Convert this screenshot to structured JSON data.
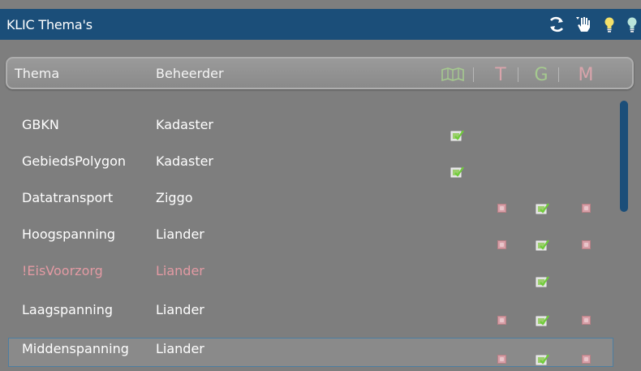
{
  "window": {
    "title": "KLIC Thema's",
    "icons": [
      "refresh-icon",
      "hand-pointer-icon",
      "lightbulb-icon",
      "lightbulb-icon"
    ]
  },
  "header": {
    "thema_label": "Thema",
    "beheerder_label": "Beheerder",
    "map_icon": "map-icon",
    "col_t": "T",
    "col_g": "G",
    "col_m": "M"
  },
  "colors": {
    "titlebar": "#1b4e79",
    "background": "#7e7e7e",
    "check_green": "#8ed44a",
    "x_pink": "#d79fa7",
    "warn_text": "#e39aa3",
    "header_map_green": "#a5c98f",
    "header_t_pink": "#d9a4ab",
    "header_g_green": "#a5c98f",
    "header_m_pink": "#d9a4ab"
  },
  "rows": [
    {
      "thema": "GBKN",
      "beheerder": "Kadaster",
      "map": "check",
      "t": "",
      "g": "",
      "m": ""
    },
    {
      "thema": "GebiedsPolygon",
      "beheerder": "Kadaster",
      "map": "check",
      "t": "",
      "g": "",
      "m": ""
    },
    {
      "thema": "Datatransport",
      "beheerder": "Ziggo",
      "map": "",
      "t": "x",
      "g": "check",
      "m": "x"
    },
    {
      "thema": "Hoogspanning",
      "beheerder": "Liander",
      "map": "",
      "t": "x",
      "g": "check",
      "m": "x"
    },
    {
      "thema": "!EisVoorzorg",
      "beheerder": "Liander",
      "map": "",
      "t": "",
      "g": "check",
      "m": "",
      "warning": true
    },
    {
      "thema": "Laagspanning",
      "beheerder": "Liander",
      "map": "",
      "t": "x",
      "g": "check",
      "m": "x"
    },
    {
      "thema": "Middenspanning",
      "beheerder": "Liander",
      "map": "",
      "t": "x",
      "g": "check",
      "m": "x",
      "selected": true
    }
  ]
}
